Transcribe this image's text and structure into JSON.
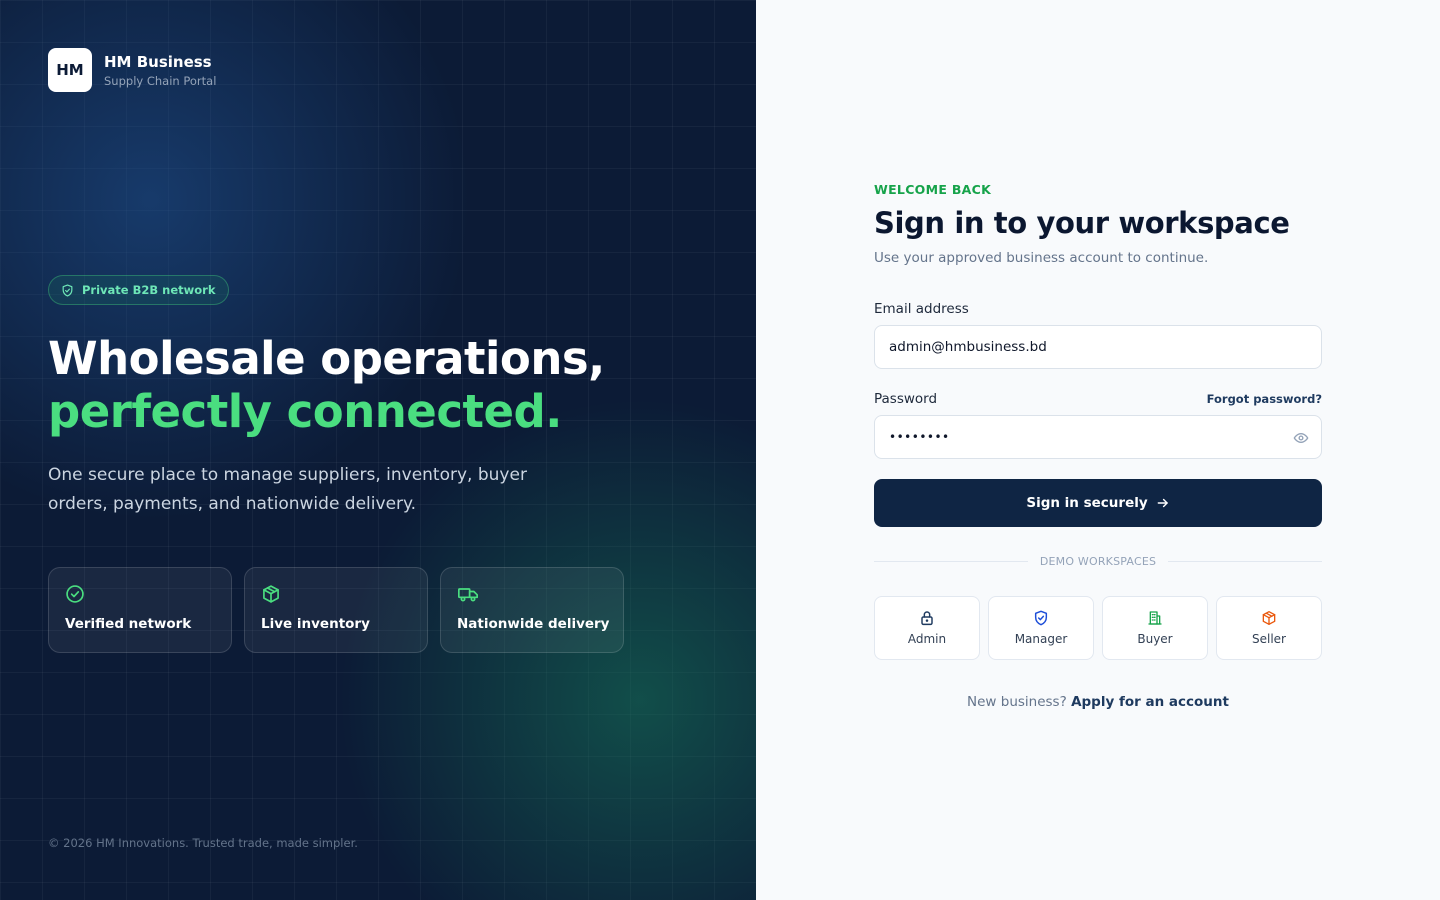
{
  "brand": {
    "logo_text": "HM",
    "name": "HM Business",
    "subtitle": "Supply Chain Portal"
  },
  "hero": {
    "badge": "Private B2B network",
    "headline_line1": "Wholesale operations,",
    "headline_line2": "perfectly connected.",
    "description": "One secure place to manage suppliers, inventory, buyer orders, payments, and nationwide delivery.",
    "features": [
      {
        "label": "Verified network",
        "icon": "check-circle-icon"
      },
      {
        "label": "Live inventory",
        "icon": "package-icon"
      },
      {
        "label": "Nationwide delivery",
        "icon": "truck-icon"
      }
    ],
    "copyright": "© 2026 HM Innovations. Trusted trade, made simpler."
  },
  "form": {
    "eyebrow": "WELCOME BACK",
    "title": "Sign in to your workspace",
    "subtitle": "Use your approved business account to continue.",
    "email_label": "Email address",
    "email_value": "admin@hmbusiness.bd",
    "password_label": "Password",
    "password_value": "••••••••",
    "forgot_label": "Forgot password?",
    "submit_label": "Sign in securely",
    "divider": "DEMO WORKSPACES",
    "demo_workspaces": [
      {
        "label": "Admin",
        "icon": "lock-icon",
        "color": "#1e3a5f"
      },
      {
        "label": "Manager",
        "icon": "shield-icon",
        "color": "#1d4ed8"
      },
      {
        "label": "Buyer",
        "icon": "building-icon",
        "color": "#16a34a"
      },
      {
        "label": "Seller",
        "icon": "package-icon",
        "color": "#ea580c"
      }
    ],
    "signup_prompt": "New business?",
    "signup_link": "Apply for an account"
  },
  "colors": {
    "navy": "#0c1b36",
    "accent_green": "#4ade80",
    "primary_button": "#0f2544"
  }
}
